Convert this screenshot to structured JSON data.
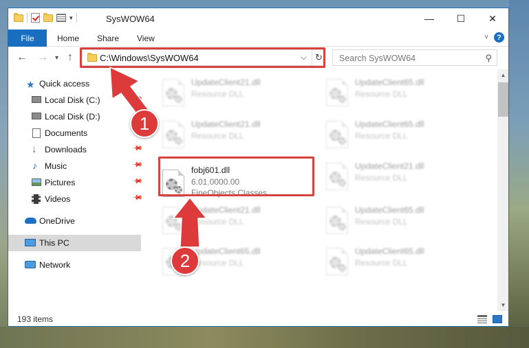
{
  "window": {
    "title": "SysWOW64",
    "controls": {
      "minimize": "—",
      "maximize": "☐",
      "close": "✕"
    }
  },
  "ribbon": {
    "tabs": [
      {
        "label": "File",
        "active": true
      },
      {
        "label": "Home"
      },
      {
        "label": "Share"
      },
      {
        "label": "View"
      }
    ],
    "accent_color": "#1a6ec0"
  },
  "navigation": {
    "back_icon": "arrow-left-icon",
    "forward_icon": "arrow-right-icon",
    "recent_icon": "chevron-down-icon",
    "up_icon": "arrow-up-icon",
    "address": "C:\\Windows\\SysWOW64",
    "search_placeholder": "Search SysWOW64"
  },
  "sidebar": {
    "items": [
      {
        "label": "Quick access",
        "icon": "star-icon"
      },
      {
        "label": "Local Disk (C:)",
        "icon": "drive-icon"
      },
      {
        "label": "Local Disk (D:)",
        "icon": "drive-icon"
      },
      {
        "label": "Documents",
        "icon": "documents-icon"
      },
      {
        "label": "Downloads",
        "icon": "download-icon"
      },
      {
        "label": "Music",
        "icon": "music-icon"
      },
      {
        "label": "Pictures",
        "icon": "pictures-icon"
      },
      {
        "label": "Videos",
        "icon": "videos-icon"
      },
      {
        "label": "OneDrive",
        "icon": "cloud-icon"
      },
      {
        "label": "This PC",
        "icon": "computer-icon",
        "selected": true
      },
      {
        "label": "Network",
        "icon": "network-icon"
      }
    ]
  },
  "files": {
    "highlighted": {
      "name": "fobj601.dll",
      "version": "6.01.0000.00",
      "description": "FineObjects Classes..."
    },
    "left_column": [
      {
        "name": "UpdateClient21.dll",
        "type": "Resource DLL"
      },
      {
        "name": "UpdateClient21.dll",
        "type": "Resource DLL"
      },
      {
        "name": "UpdateClient21.dll",
        "type": "Resource DLL"
      },
      {
        "name": "UpdateClient65.dll",
        "type": "Resource DLL"
      }
    ],
    "right_column": [
      {
        "name": "UpdateClient65.dll",
        "type": "Resource DLL"
      },
      {
        "name": "UpdateClient65.dll",
        "type": "Resource DLL"
      },
      {
        "name": "UpdateClient21.dll",
        "type": "Resource DLL"
      },
      {
        "name": "UpdateClient65.dll",
        "type": "Resource DLL"
      },
      {
        "name": "UpdateClient65.dll",
        "type": "Resource DLL"
      }
    ]
  },
  "status": {
    "item_count": "193 items"
  },
  "annotations": {
    "step1": "1",
    "step2": "2",
    "color": "#dd3b3b"
  }
}
